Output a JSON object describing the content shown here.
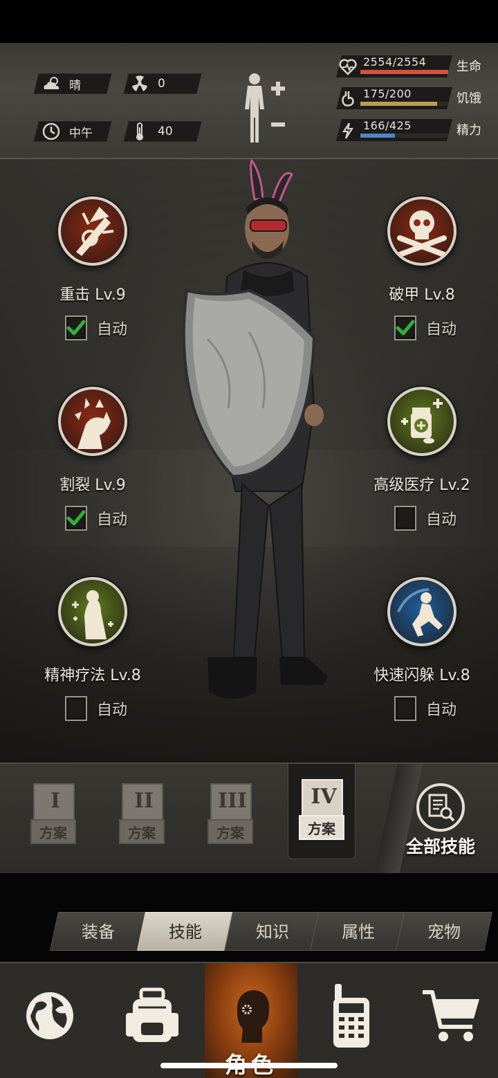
{
  "header": {
    "weather": {
      "icon": "cloud-sun-icon",
      "value": "晴"
    },
    "radiation": {
      "icon": "radiation-icon",
      "value": "0"
    },
    "time": {
      "icon": "clock-icon",
      "value": "中午"
    },
    "temperature": {
      "icon": "thermometer-icon",
      "value": "40"
    },
    "body_icon": "body-figure-icon",
    "bars": [
      {
        "key": "health",
        "icon": "heart-icon",
        "text": "2554/2554",
        "label": "生命",
        "fraction": 1.0,
        "color": "#d9503f"
      },
      {
        "key": "hunger",
        "icon": "stomach-icon",
        "text": "175/200",
        "label": "饥饿",
        "fraction": 0.875,
        "color": "#bf9a52"
      },
      {
        "key": "energy",
        "icon": "energy-icon",
        "text": "166/425",
        "label": "精力",
        "fraction": 0.39,
        "color": "#4f86c3"
      }
    ]
  },
  "skills": {
    "auto_label": "自动",
    "left": [
      {
        "name": "重击 Lv.9",
        "icon": "heavy-strike-icon",
        "auto": true,
        "color": "#8a2a14"
      },
      {
        "name": "割裂 Lv.9",
        "icon": "rend-icon",
        "auto": true,
        "color": "#8a2a14"
      },
      {
        "name": "精神疗法 Lv.8",
        "icon": "mental-therapy-icon",
        "auto": false,
        "color": "#5e7a1e"
      }
    ],
    "right": [
      {
        "name": "破甲 Lv.8",
        "icon": "skull-crossbones-icon",
        "auto": true,
        "color": "#8a2a14"
      },
      {
        "name": "高级医疗 Lv.2",
        "icon": "advanced-medical-icon",
        "auto": false,
        "color": "#5e7a1e"
      },
      {
        "name": "快速闪躲 Lv.8",
        "icon": "quick-dodge-icon",
        "auto": false,
        "color": "#1f5e9c"
      }
    ]
  },
  "plans": {
    "items": [
      {
        "numeral": "I",
        "label": "方案",
        "active": false
      },
      {
        "numeral": "II",
        "label": "方案",
        "active": false
      },
      {
        "numeral": "III",
        "label": "方案",
        "active": false
      },
      {
        "numeral": "IV",
        "label": "方案",
        "active": true
      }
    ],
    "all_skills_label": "全部技能",
    "all_skills_icon": "document-search-icon"
  },
  "sub_tabs": [
    {
      "label": "装备",
      "active": false
    },
    {
      "label": "技能",
      "active": true
    },
    {
      "label": "知识",
      "active": false
    },
    {
      "label": "属性",
      "active": false
    },
    {
      "label": "宠物",
      "active": false
    }
  ],
  "bottom_nav": [
    {
      "icon": "globe-icon",
      "label": "",
      "active": false
    },
    {
      "icon": "backpack-icon",
      "label": "",
      "active": false
    },
    {
      "icon": "character-head-icon",
      "label": "角色",
      "active": true
    },
    {
      "icon": "radio-icon",
      "label": "",
      "active": false
    },
    {
      "icon": "cart-icon",
      "label": "",
      "active": false
    }
  ]
}
